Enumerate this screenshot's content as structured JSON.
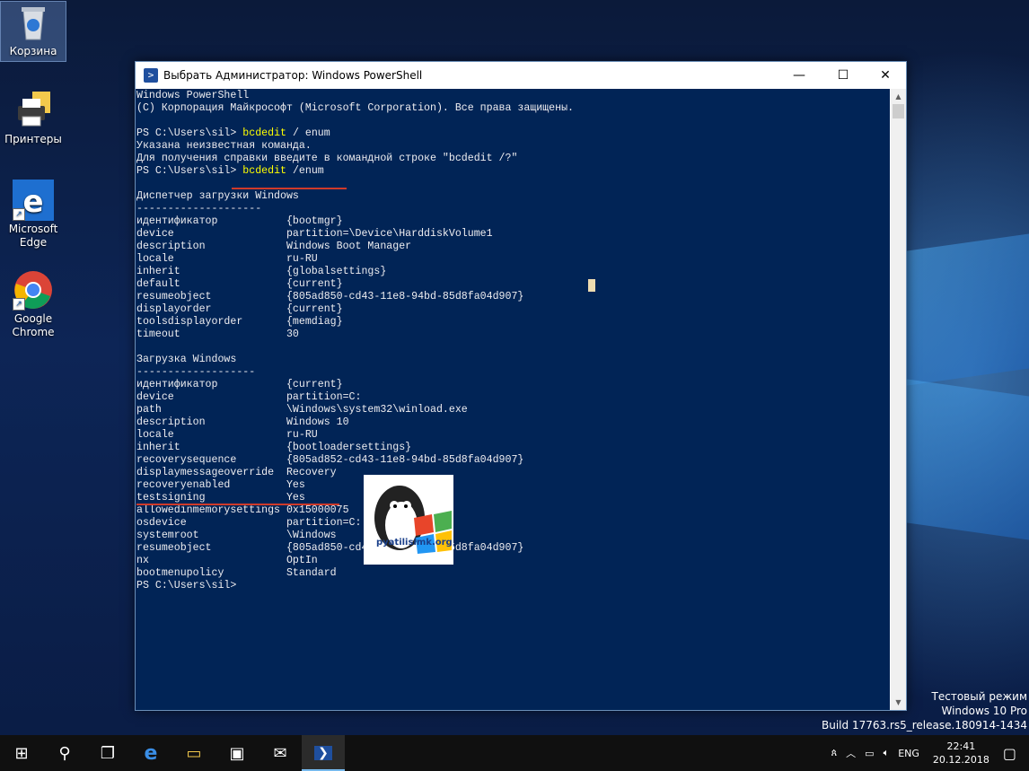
{
  "desktop": {
    "icons": [
      {
        "label": "Корзина"
      },
      {
        "label": "Принтеры"
      },
      {
        "label": "Microsoft Edge"
      },
      {
        "label": "Google Chrome"
      }
    ],
    "watermark": {
      "line1": "Тестовый режим",
      "line2": "Windows 10 Pro",
      "line3": "Build 17763.rs5_release.180914-1434"
    }
  },
  "window": {
    "title": "Выбрать Администратор: Windows PowerShell",
    "controls": {
      "minimize": "—",
      "maximize": "☐",
      "close": "✕"
    }
  },
  "console": {
    "lines": [
      "Windows PowerShell",
      "(C) Корпорация Майкрософт (Microsoft Corporation). Все права защищены.",
      "",
      "PS C:\\Users\\sil> |bcdedit| / enum",
      "Указана неизвестная команда.",
      "Для получения справки введите в командной строке \"bcdedit /?\"",
      "PS C:\\Users\\sil> |bcdedit| /enum",
      "",
      "Диспетчер загрузки Windows",
      "--------------------",
      "идентификатор           {bootmgr}",
      "device                  partition=\\Device\\HarddiskVolume1",
      "description             Windows Boot Manager",
      "locale                  ru-RU",
      "inherit                 {globalsettings}",
      "default                 {current}",
      "resumeobject            {805ad850-cd43-11e8-94bd-85d8fa04d907}",
      "displayorder            {current}",
      "toolsdisplayorder       {memdiag}",
      "timeout                 30",
      "",
      "Загрузка Windows",
      "-------------------",
      "идентификатор           {current}",
      "device                  partition=C:",
      "path                    \\Windows\\system32\\winload.exe",
      "description             Windows 10",
      "locale                  ru-RU",
      "inherit                 {bootloadersettings}",
      "recoverysequence        {805ad852-cd43-11e8-94bd-85d8fa04d907}",
      "displaymessageoverride  Recovery",
      "recoveryenabled         Yes",
      "testsigning             Yes",
      "allowedinmemorysettings 0x15000075",
      "osdevice                partition=C:",
      "systemroot              \\Windows",
      "resumeobject            {805ad850-cd43-11e8-94bd-85d8fa04d907}",
      "nx                      OptIn",
      "bootmenupolicy          Standard",
      "PS C:\\Users\\sil>"
    ],
    "overlay_logo_text": "pyatilisimk.org"
  },
  "taskbar": {
    "buttons": [
      {
        "name": "start-button",
        "icon": "windows-icon",
        "glyph": "⊞"
      },
      {
        "name": "search-button",
        "icon": "search-icon",
        "glyph": "⚲"
      },
      {
        "name": "task-view-button",
        "icon": "task-view-icon",
        "glyph": "❐"
      },
      {
        "name": "edge-taskbar-button",
        "icon": "edge-icon",
        "glyph": "e"
      },
      {
        "name": "explorer-taskbar-button",
        "icon": "folder-icon",
        "glyph": "▭"
      },
      {
        "name": "store-taskbar-button",
        "icon": "store-icon",
        "glyph": "▣"
      },
      {
        "name": "mail-taskbar-button",
        "icon": "mail-icon",
        "glyph": "✉"
      },
      {
        "name": "powershell-taskbar-button",
        "icon": "powershell-icon",
        "glyph": "❯"
      }
    ],
    "tray": {
      "language": "ENG",
      "time": "22:41",
      "date": "20.12.2018"
    }
  }
}
